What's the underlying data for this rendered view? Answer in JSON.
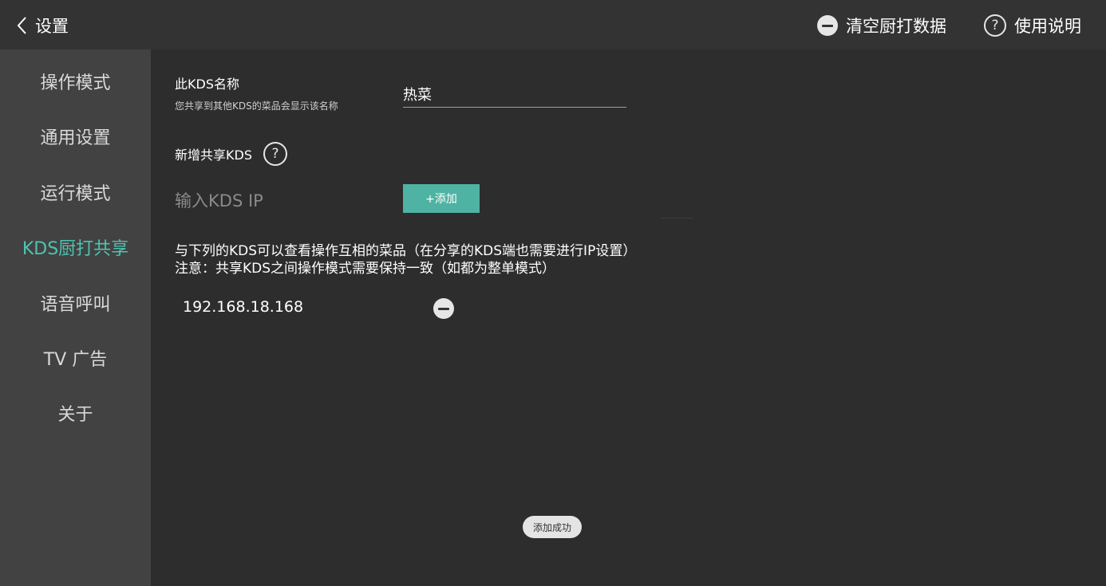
{
  "topbar": {
    "back_label": "设置",
    "clear_label": "清空厨打数据",
    "help_label": "使用说明"
  },
  "sidebar": {
    "items": [
      {
        "label": "操作模式"
      },
      {
        "label": "通用设置"
      },
      {
        "label": "运行模式"
      },
      {
        "label": "KDS厨打共享",
        "active": true
      },
      {
        "label": "语音呼叫"
      },
      {
        "label": "TV 广告"
      },
      {
        "label": "关于"
      }
    ]
  },
  "main": {
    "name_title": "此KDS名称",
    "name_subtitle": "您共享到其他KDS的菜品会显示该名称",
    "name_value": "热菜",
    "share_title": "新增共享KDS",
    "help_glyph": "?",
    "ip_placeholder": "输入KDS IP",
    "add_button": "+添加",
    "notice_line1": "与下列的KDS可以查看操作互相的菜品（在分享的KDS端也需要进行IP设置）",
    "notice_line2": "注意：共享KDS之间操作模式需要保持一致（如都为整单模式）",
    "shared_ips": [
      "192.168.18.168"
    ],
    "toast": "添加成功"
  },
  "colors": {
    "accent": "#4fc3b1",
    "button": "#4fb3a3",
    "background": "#2d2d2d",
    "sidebar": "#424242"
  }
}
